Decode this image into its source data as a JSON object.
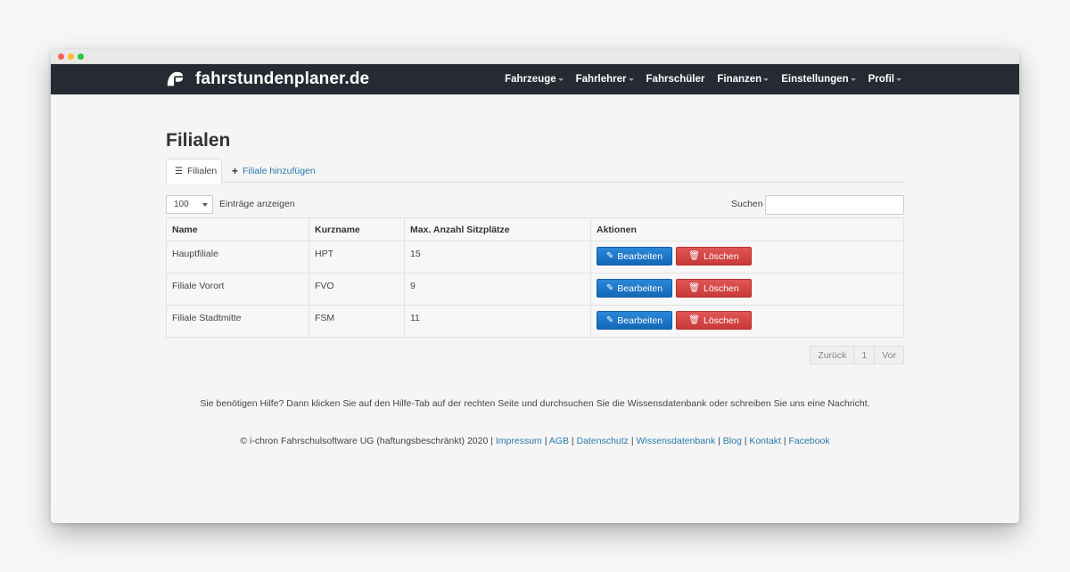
{
  "brand": {
    "name": "fahrstundenplaner.de",
    "icon": "helmet-logo-icon"
  },
  "nav": [
    {
      "label": "Fahrzeuge",
      "dropdown": true
    },
    {
      "label": "Fahrlehrer",
      "dropdown": true
    },
    {
      "label": "Fahrschüler",
      "dropdown": false
    },
    {
      "label": "Finanzen",
      "dropdown": true
    },
    {
      "label": "Einstellungen",
      "dropdown": true
    },
    {
      "label": "Profil",
      "dropdown": true
    }
  ],
  "page": {
    "title": "Filialen"
  },
  "tabs": {
    "active": "Filialen",
    "add": "Filiale hinzufügen"
  },
  "controls": {
    "length_value": "100",
    "length_label": "Einträge anzeigen",
    "search_label": "Suchen",
    "search_value": ""
  },
  "table": {
    "headers": [
      "Name",
      "Kurzname",
      "Max. Anzahl Sitzplätze",
      "Aktionen"
    ],
    "rows": [
      {
        "name": "Hauptfiliale",
        "short": "HPT",
        "seats": "15"
      },
      {
        "name": "Filiale Vorort",
        "short": "FVO",
        "seats": "9"
      },
      {
        "name": "Filiale Stadtmitte",
        "short": "FSM",
        "seats": "11"
      }
    ],
    "edit_label": "Bearbeiten",
    "delete_label": "Löschen"
  },
  "pagination": {
    "prev": "Zurück",
    "page": "1",
    "next": "Vor"
  },
  "help_text": "Sie benötigen Hilfe? Dann klicken Sie auf den Hilfe-Tab auf der rechten Seite und durchsuchen Sie die Wissensdatenbank oder schreiben Sie uns eine Nachricht.",
  "footer": {
    "copyright": "© i-chron Fahrschulsoftware UG (haftungsbeschränkt) 2020",
    "links": [
      "Impressum",
      "AGB",
      "Datenschutz",
      "Wissensdatenbank",
      "Blog",
      "Kontakt",
      "Facebook"
    ]
  },
  "colors": {
    "navbar": "#252a33",
    "primary": "#1467b8",
    "danger": "#c93838",
    "link": "#2a7ab0"
  }
}
